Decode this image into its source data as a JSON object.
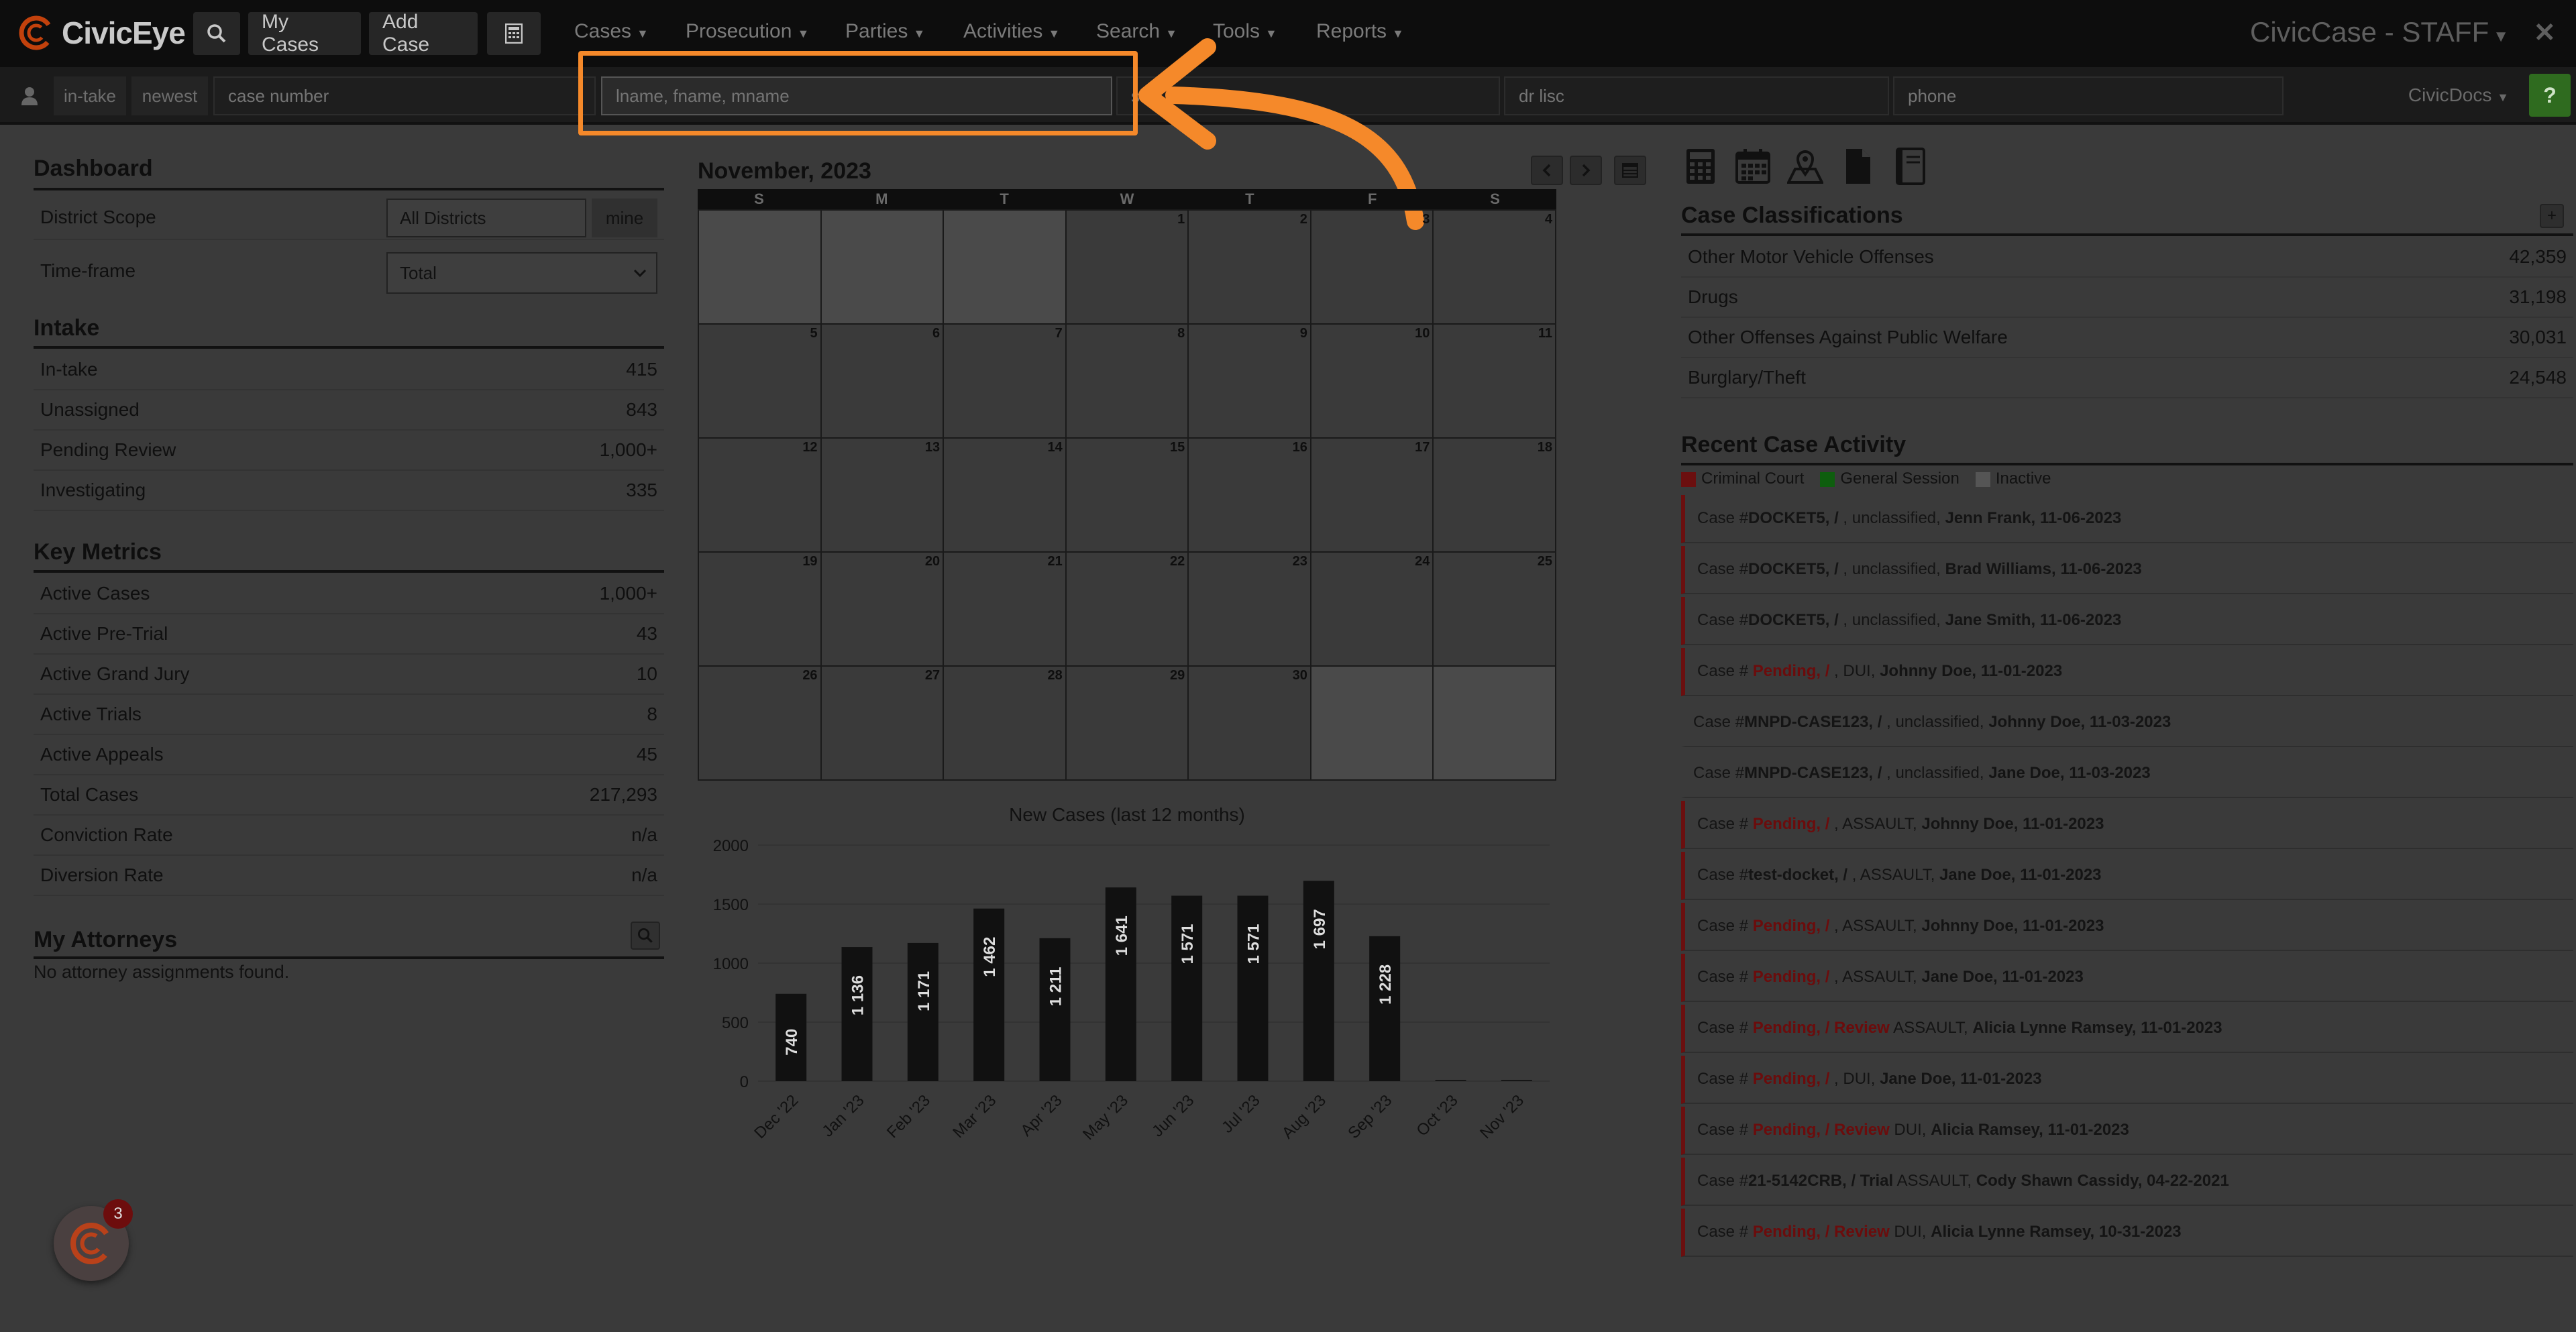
{
  "navbar": {
    "brand": "CivicEye",
    "my_cases": "My Cases",
    "add_case": "Add Case",
    "menus": [
      "Cases",
      "Prosecution",
      "Parties",
      "Activities",
      "Search",
      "Tools",
      "Reports"
    ],
    "app_title": "CivicCase - STAFF",
    "close": "✕"
  },
  "searchbar": {
    "tabs": [
      "in-take",
      "newest"
    ],
    "case_number_placeholder": "case number",
    "name_placeholder": "lname, fname, mname",
    "ssn_placeholder": "ssn",
    "dr_lisc_placeholder": "dr lisc",
    "phone_placeholder": "phone",
    "civicdocs": "CivicDocs",
    "help": "?"
  },
  "dashboard": {
    "title": "Dashboard",
    "district_scope_label": "District Scope",
    "district_scope_value": "All Districts",
    "mine_button": "mine",
    "timeframe_label": "Time-frame",
    "timeframe_value": "Total"
  },
  "intake": {
    "title": "Intake",
    "rows": [
      {
        "label": "In-take",
        "value": "415"
      },
      {
        "label": "Unassigned",
        "value": "843"
      },
      {
        "label": "Pending Review",
        "value": "1,000+"
      },
      {
        "label": "Investigating",
        "value": "335"
      }
    ]
  },
  "key_metrics": {
    "title": "Key Metrics",
    "rows": [
      {
        "label": "Active Cases",
        "value": "1,000+"
      },
      {
        "label": "Active Pre-Trial",
        "value": "43"
      },
      {
        "label": "Active Grand Jury",
        "value": "10"
      },
      {
        "label": "Active Trials",
        "value": "8"
      },
      {
        "label": "Active Appeals",
        "value": "45"
      },
      {
        "label": "Total Cases",
        "value": "217,293"
      },
      {
        "label": "Conviction Rate",
        "value": "n/a"
      },
      {
        "label": "Diversion Rate",
        "value": "n/a"
      }
    ]
  },
  "attorneys": {
    "title": "My Attorneys",
    "empty": "No attorney assignments found."
  },
  "calendar": {
    "title": "November, 2023",
    "weekdays": [
      "S",
      "M",
      "T",
      "W",
      "T",
      "F",
      "S"
    ],
    "days": [
      "",
      "",
      "",
      "1",
      "2",
      "3",
      "4",
      "5",
      "6",
      "7",
      "8",
      "9",
      "10",
      "11",
      "12",
      "13",
      "14",
      "15",
      "16",
      "17",
      "18",
      "19",
      "20",
      "21",
      "22",
      "23",
      "24",
      "25",
      "26",
      "27",
      "28",
      "29",
      "30",
      "",
      ""
    ]
  },
  "chart_data": {
    "type": "bar",
    "title": "New Cases (last 12 months)",
    "categories": [
      "Dec '22",
      "Jan '23",
      "Feb '23",
      "Mar '23",
      "Apr '23",
      "May '23",
      "Jun '23",
      "Jul '23",
      "Aug '23",
      "Sep '23",
      "Oct '23",
      "Nov '23"
    ],
    "values": [
      740,
      1136,
      1171,
      1462,
      1211,
      1641,
      1571,
      1571,
      1697,
      1228,
      10,
      10
    ],
    "labels": [
      "740",
      "1 136",
      "1 171",
      "1 462",
      "1 211",
      "1 641",
      "1 571",
      "1 571",
      "1 697",
      "1 228",
      "",
      ""
    ],
    "yticks": [
      0,
      500,
      1000,
      1500,
      2000
    ],
    "ylim": [
      0,
      2000
    ],
    "bar_color": "#111111"
  },
  "classifications": {
    "title": "Case Classifications",
    "plus": "+",
    "rows": [
      {
        "label": "Other Motor Vehicle Offenses",
        "value": "42,359"
      },
      {
        "label": "Drugs",
        "value": "31,198"
      },
      {
        "label": "Other Offenses Against Public Welfare",
        "value": "30,031"
      },
      {
        "label": "Burglary/Theft",
        "value": "24,548"
      }
    ]
  },
  "activity": {
    "title": "Recent Case Activity",
    "legend": [
      {
        "label": "Criminal Court",
        "color": "#6b0f0f"
      },
      {
        "label": "General Session",
        "color": "#0e5e0e"
      },
      {
        "label": "Inactive",
        "color": "#555555"
      }
    ],
    "items": [
      {
        "type": "crim",
        "prefix": "Case #",
        "docket": "DOCKET5, /",
        "pending": false,
        "desc": " , unclassified, ",
        "person": "Jenn Frank, 11-06-2023"
      },
      {
        "type": "crim",
        "prefix": "Case #",
        "docket": "DOCKET5, /",
        "pending": false,
        "desc": " , unclassified, ",
        "person": "Brad Williams, 11-06-2023"
      },
      {
        "type": "crim",
        "prefix": "Case #",
        "docket": "DOCKET5, /",
        "pending": false,
        "desc": " , unclassified, ",
        "person": "Jane Smith, 11-06-2023"
      },
      {
        "type": "crim",
        "prefix": "Case # ",
        "docket": "Pending, /",
        "pending": true,
        "desc": " , DUI, ",
        "person": "Johnny Doe, 11-01-2023"
      },
      {
        "type": "none",
        "prefix": "Case #",
        "docket": "MNPD-CASE123, /",
        "pending": false,
        "desc": " , unclassified, ",
        "person": "Johnny Doe, 11-03-2023"
      },
      {
        "type": "none",
        "prefix": "Case #",
        "docket": "MNPD-CASE123, /",
        "pending": false,
        "desc": " , unclassified, ",
        "person": "Jane Doe, 11-03-2023"
      },
      {
        "type": "crim",
        "prefix": "Case # ",
        "docket": "Pending, /",
        "pending": true,
        "desc": " , ASSAULT, ",
        "person": "Johnny Doe, 11-01-2023"
      },
      {
        "type": "crim",
        "prefix": "Case #",
        "docket": "test-docket, /",
        "pending": false,
        "desc": " , ASSAULT, ",
        "person": "Jane Doe, 11-01-2023"
      },
      {
        "type": "crim",
        "prefix": "Case # ",
        "docket": "Pending, /",
        "pending": true,
        "desc": " , ASSAULT, ",
        "person": "Johnny Doe, 11-01-2023"
      },
      {
        "type": "crim",
        "prefix": "Case # ",
        "docket": "Pending, /",
        "pending": true,
        "desc": " , ASSAULT, ",
        "person": "Jane Doe, 11-01-2023"
      },
      {
        "type": "crim",
        "prefix": "Case # ",
        "docket": "Pending, / Review",
        "pending": true,
        "desc": " ASSAULT, ",
        "person": "Alicia Lynne Ramsey, 11-01-2023"
      },
      {
        "type": "crim",
        "prefix": "Case # ",
        "docket": "Pending, /",
        "pending": true,
        "desc": " , DUI, ",
        "person": "Jane Doe, 11-01-2023"
      },
      {
        "type": "crim",
        "prefix": "Case # ",
        "docket": "Pending, / Review",
        "pending": true,
        "desc": " DUI, ",
        "person": "Alicia Ramsey, 11-01-2023"
      },
      {
        "type": "crim",
        "prefix": "Case #",
        "docket": "21-5142CRB, / Trial",
        "pending": false,
        "desc": " ASSAULT, ",
        "person": "Cody Shawn Cassidy, 04-22-2021"
      },
      {
        "type": "crim",
        "prefix": "Case # ",
        "docket": "Pending, / Review",
        "pending": true,
        "desc": " DUI, ",
        "person": "Alicia Lynne Ramsey, 10-31-2023"
      }
    ]
  },
  "chat": {
    "badge": "3"
  }
}
